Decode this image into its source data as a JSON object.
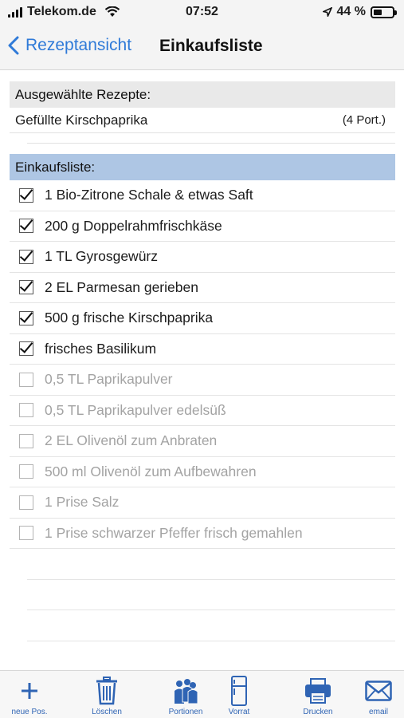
{
  "status_bar": {
    "carrier": "Telekom.de",
    "time": "07:52",
    "battery": "44 %",
    "battery_level": 0.44
  },
  "nav": {
    "back_label": "Rezeptansicht",
    "title": "Einkaufsliste"
  },
  "selected": {
    "header": "Ausgewählte Rezepte:",
    "recipe_name": "Gefüllte Kirschpaprika",
    "recipe_portions": "(4 Port.)"
  },
  "shopping": {
    "header": "Einkaufsliste:",
    "items": [
      {
        "label": "1 Bio-Zitrone Schale & etwas Saft",
        "checked": true
      },
      {
        "label": "200 g Doppelrahmfrischkäse",
        "checked": true
      },
      {
        "label": "1 TL Gyrosgewürz",
        "checked": true
      },
      {
        "label": "2 EL Parmesan gerieben",
        "checked": true
      },
      {
        "label": "500 g frische Kirschpaprika",
        "checked": true
      },
      {
        "label": "frisches Basilikum",
        "checked": true
      },
      {
        "label": "0,5 TL Paprikapulver",
        "checked": false
      },
      {
        "label": "0,5 TL Paprikapulver edelsüß",
        "checked": false
      },
      {
        "label": "2 EL Olivenöl zum Anbraten",
        "checked": false
      },
      {
        "label": "500 ml Olivenöl zum Aufbewahren",
        "checked": false
      },
      {
        "label": "1 Prise Salz",
        "checked": false
      },
      {
        "label": "1 Prise schwarzer Pfeffer frisch gemahlen",
        "checked": false
      }
    ]
  },
  "tab_bar": {
    "new_item": {
      "label": "neue Pos.",
      "icon": "plus-icon"
    },
    "delete": {
      "label": "Löschen",
      "icon": "trash-icon"
    },
    "portions": {
      "label": "Portionen",
      "icon": "people-icon"
    },
    "pantry": {
      "label": "Vorrat",
      "icon": "fridge-icon"
    },
    "print": {
      "label": "Drucken",
      "icon": "printer-icon"
    },
    "email": {
      "label": "email",
      "icon": "envelope-icon"
    }
  },
  "colors": {
    "accent": "#2f7ad8",
    "tab_icon": "#2f64b4",
    "section_blue": "#aec6e4",
    "section_gray": "#e9e9e9"
  }
}
